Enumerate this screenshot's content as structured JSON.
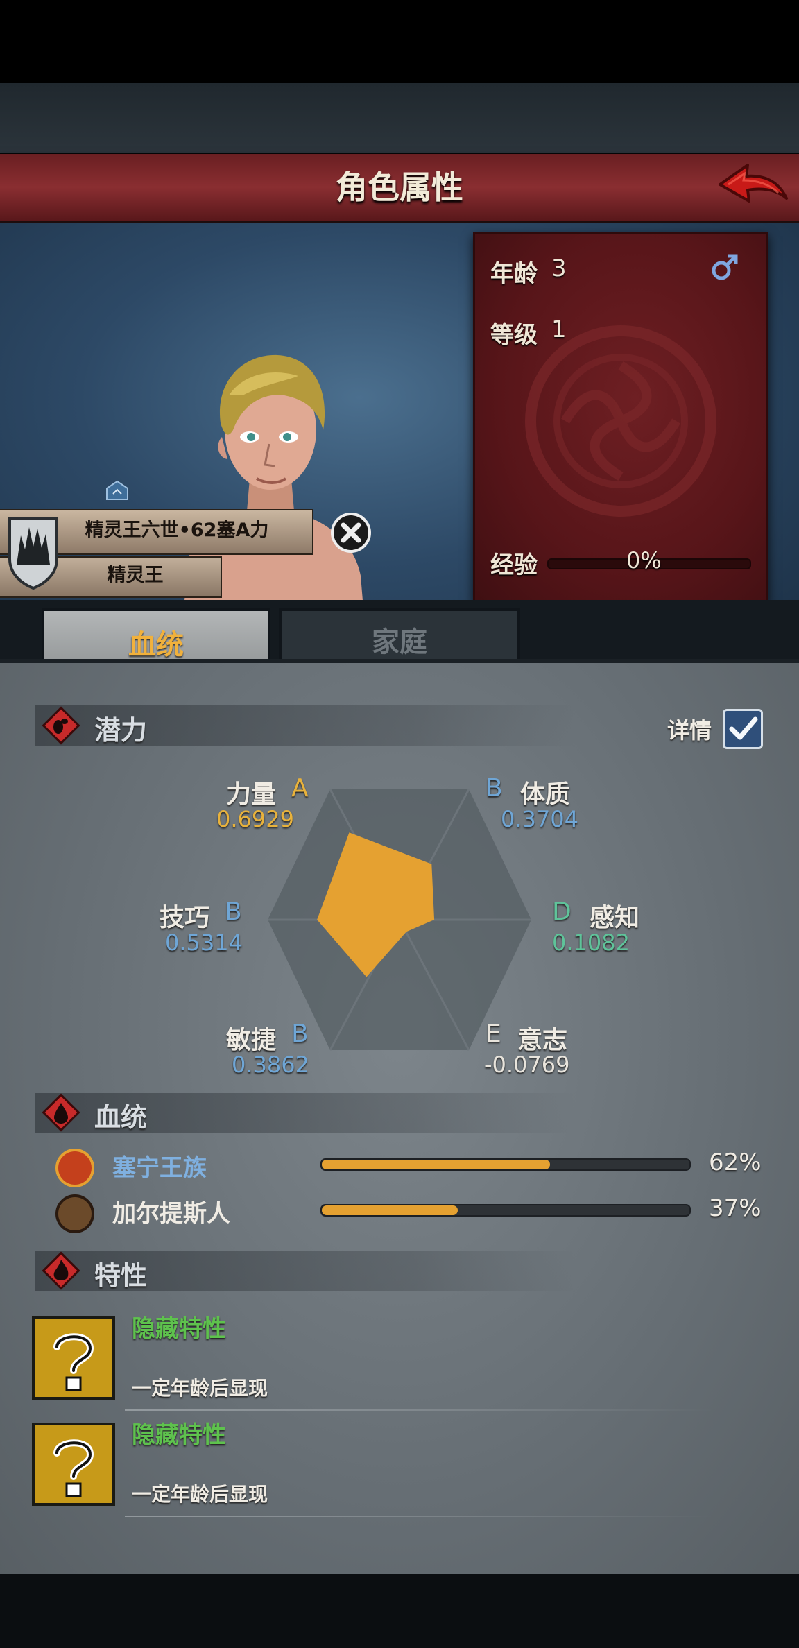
{
  "screen": {
    "title": "角色属性"
  },
  "character": {
    "age_label": "年龄",
    "age": "3",
    "level_label": "等级",
    "level": "1",
    "exp_label": "经验",
    "exp_percent": "0%",
    "exp_fraction": 0,
    "gender_icon": "male-symbol-icon",
    "name": "精灵王六世•62塞A力",
    "title": "精灵王"
  },
  "tabs": [
    {
      "label": "血统",
      "active": true
    },
    {
      "label": "家庭",
      "active": false
    }
  ],
  "potential": {
    "section_title": "潜力",
    "details_label": "详情",
    "details_checked": true,
    "attributes": [
      {
        "name": "力量",
        "grade": "A",
        "value": "0.6929",
        "grade_color": "#e8b23c"
      },
      {
        "name": "体质",
        "grade": "B",
        "value": "0.3704",
        "grade_color": "#6fa6d6"
      },
      {
        "name": "感知",
        "grade": "D",
        "value": "0.1082",
        "grade_color": "#5fc39a"
      },
      {
        "name": "意志",
        "grade": "E",
        "value": "-0.0769",
        "grade_color": "#e8e4dc"
      },
      {
        "name": "敏捷",
        "grade": "B",
        "value": "0.3862",
        "grade_color": "#6fa6d6"
      },
      {
        "name": "技巧",
        "grade": "B",
        "value": "0.5314",
        "grade_color": "#6fa6d6"
      }
    ],
    "radar_fill": "#e5a131"
  },
  "bloodline": {
    "section_title": "血统",
    "lines": [
      {
        "name": "塞宁王族",
        "percent": "62%",
        "fraction": 0.62,
        "name_color": "#7fb0e0"
      },
      {
        "name": "加尔提斯人",
        "percent": "37%",
        "fraction": 0.37,
        "name_color": "#f0ece4"
      }
    ]
  },
  "traits": {
    "section_title": "特性",
    "items": [
      {
        "name": "隐藏特性",
        "desc": "一定年龄后显现"
      },
      {
        "name": "隐藏特性",
        "desc": "一定年龄后显现"
      }
    ]
  }
}
